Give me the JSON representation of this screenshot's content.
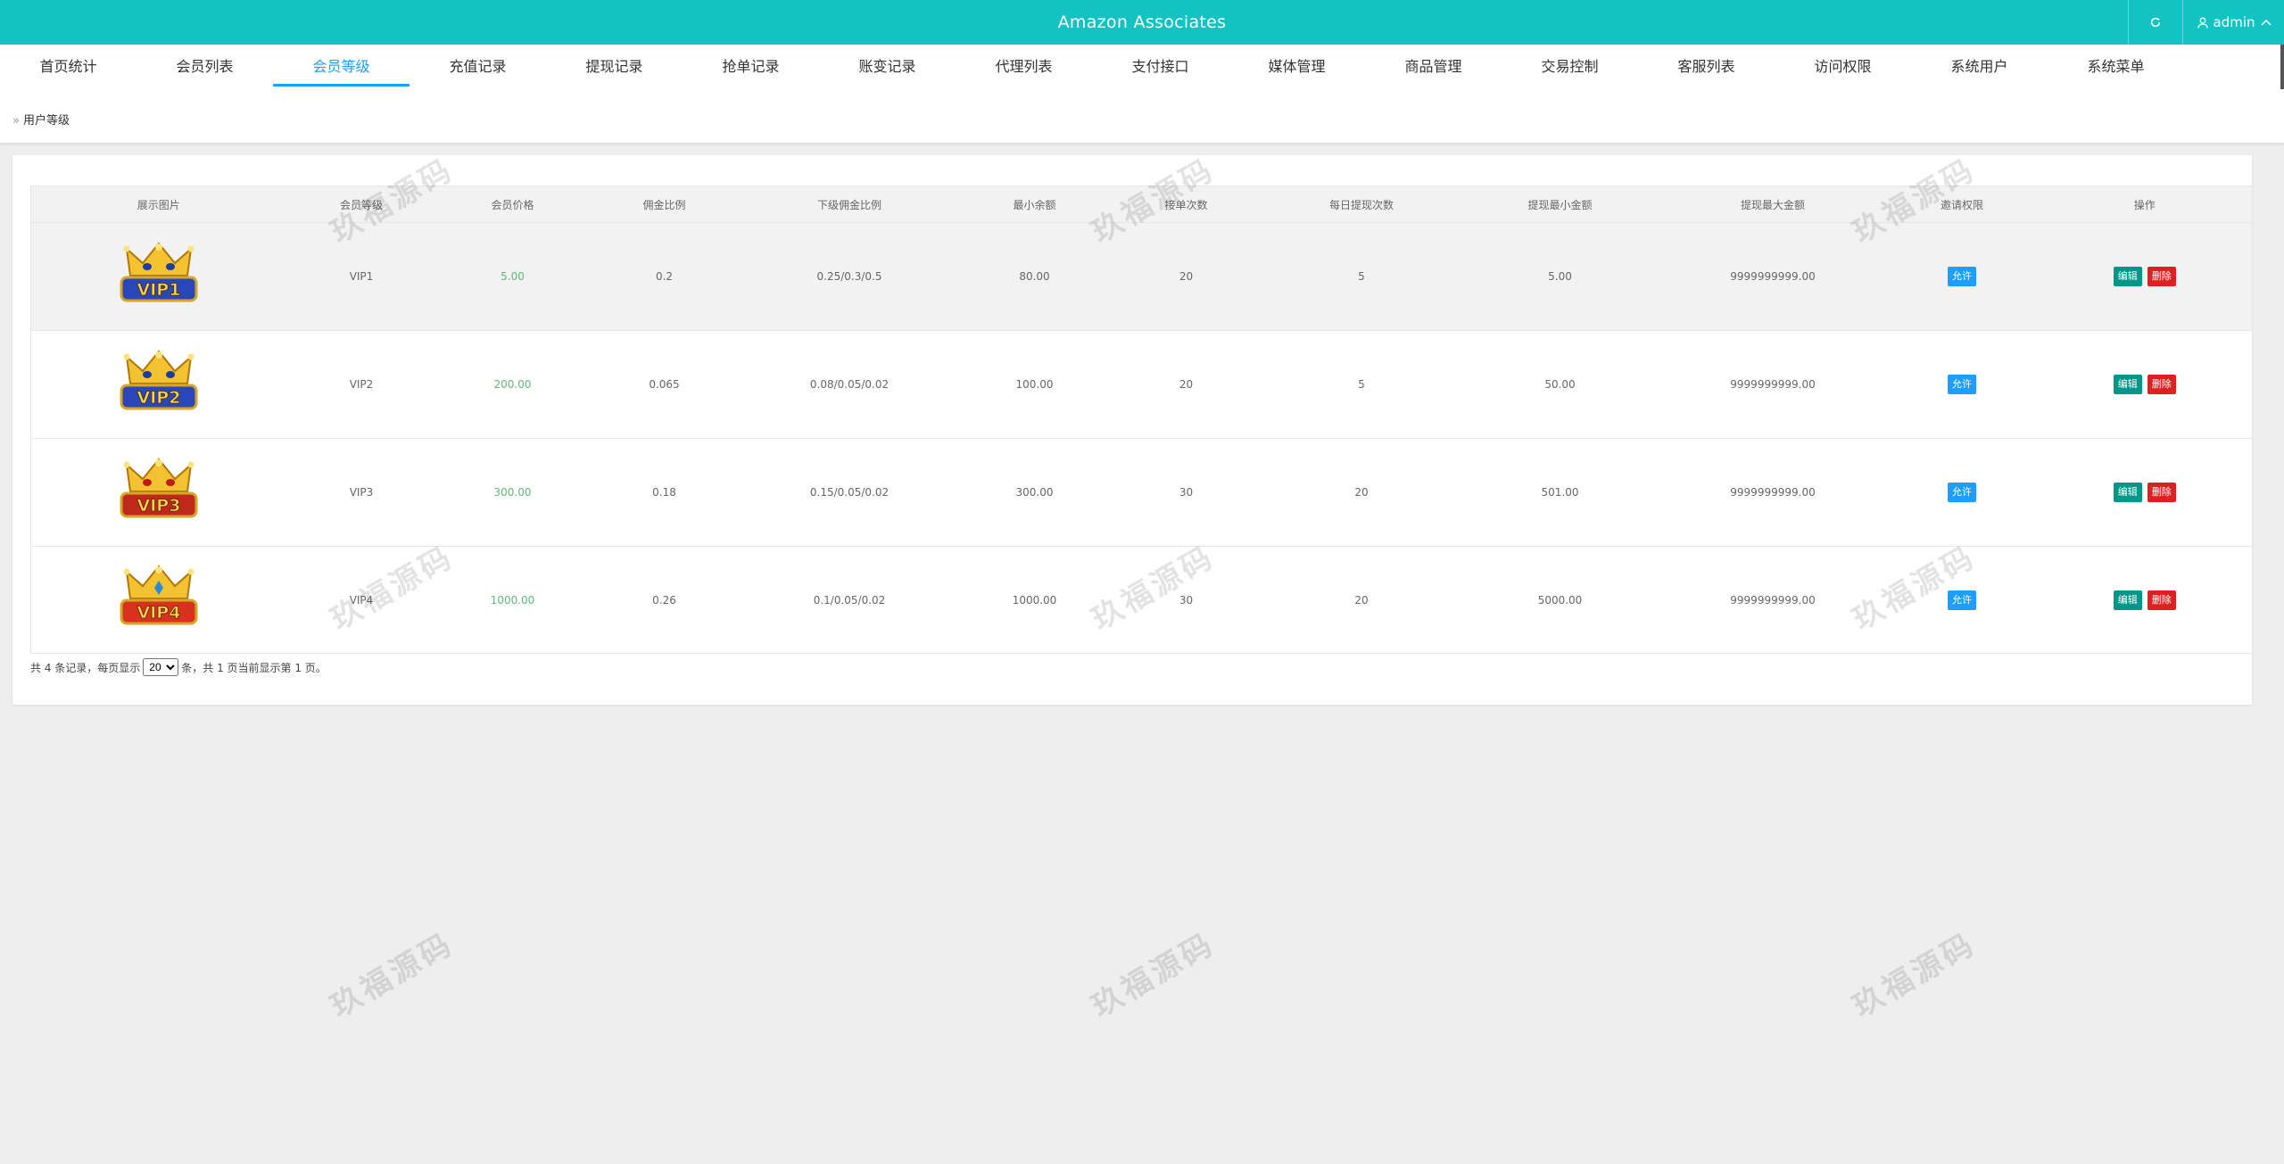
{
  "header": {
    "title": "Amazon Associates",
    "user": "admin"
  },
  "nav": [
    {
      "label": "首页统计",
      "active": false
    },
    {
      "label": "会员列表",
      "active": false
    },
    {
      "label": "会员等级",
      "active": true
    },
    {
      "label": "充值记录",
      "active": false
    },
    {
      "label": "提现记录",
      "active": false
    },
    {
      "label": "抢单记录",
      "active": false
    },
    {
      "label": "账变记录",
      "active": false
    },
    {
      "label": "代理列表",
      "active": false
    },
    {
      "label": "支付接口",
      "active": false
    },
    {
      "label": "媒体管理",
      "active": false
    },
    {
      "label": "商品管理",
      "active": false
    },
    {
      "label": "交易控制",
      "active": false
    },
    {
      "label": "客服列表",
      "active": false
    },
    {
      "label": "访问权限",
      "active": false
    },
    {
      "label": "系统用户",
      "active": false
    },
    {
      "label": "系统菜单",
      "active": false
    }
  ],
  "breadcrumb": {
    "label": "用户等级"
  },
  "table": {
    "columns": [
      "展示图片",
      "会员等级",
      "会员价格",
      "佣金比例",
      "下级佣金比例",
      "最小余额",
      "接单次数",
      "每日提现次数",
      "提现最小金额",
      "提现最大金额",
      "邀请权限",
      "操作"
    ],
    "rows": [
      {
        "badge": "VIP1",
        "level": "VIP1",
        "price": "5.00",
        "rate": "0.2",
        "sub_rate": "0.25/0.3/0.5",
        "min_balance": "80.00",
        "orders": "20",
        "daily_withdraw": "5",
        "withdraw_min": "5.00",
        "withdraw_max": "9999999999.00",
        "invite": "允许",
        "edit": "编辑",
        "delete": "删除"
      },
      {
        "badge": "VIP2",
        "level": "VIP2",
        "price": "200.00",
        "rate": "0.065",
        "sub_rate": "0.08/0.05/0.02",
        "min_balance": "100.00",
        "orders": "20",
        "daily_withdraw": "5",
        "withdraw_min": "50.00",
        "withdraw_max": "9999999999.00",
        "invite": "允许",
        "edit": "编辑",
        "delete": "删除"
      },
      {
        "badge": "VIP3",
        "level": "VIP3",
        "price": "300.00",
        "rate": "0.18",
        "sub_rate": "0.15/0.05/0.02",
        "min_balance": "300.00",
        "orders": "30",
        "daily_withdraw": "20",
        "withdraw_min": "501.00",
        "withdraw_max": "9999999999.00",
        "invite": "允许",
        "edit": "编辑",
        "delete": "删除"
      },
      {
        "badge": "VIP4",
        "level": "VIP4",
        "price": "1000.00",
        "rate": "0.26",
        "sub_rate": "0.1/0.05/0.02",
        "min_balance": "1000.00",
        "orders": "30",
        "daily_withdraw": "20",
        "withdraw_min": "5000.00",
        "withdraw_max": "9999999999.00",
        "invite": "允许",
        "edit": "编辑",
        "delete": "删除"
      }
    ]
  },
  "pager": {
    "prefix": "共 4 条记录，每页显示",
    "page_size": "20",
    "suffix": "条，共 1 页当前显示第 1 页。"
  },
  "watermark": "玖福源码",
  "colors": {
    "header": "#13c2c2",
    "active": "#1e9fff",
    "price": "#5fb878",
    "edit": "#009688",
    "delete": "#e02020"
  },
  "icons": {
    "refresh": "refresh-icon",
    "user": "user-icon",
    "caret": "chevron-up-icon"
  }
}
